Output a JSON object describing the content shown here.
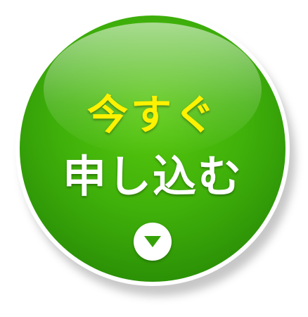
{
  "cta": {
    "line1": "今すぐ",
    "line2": "申し込む",
    "icon": "chevron-down-icon"
  },
  "colors": {
    "button_green": "#3fb00a",
    "line1_text": "#fff200",
    "line2_text": "#ffffff",
    "arrow": "#35a308"
  }
}
